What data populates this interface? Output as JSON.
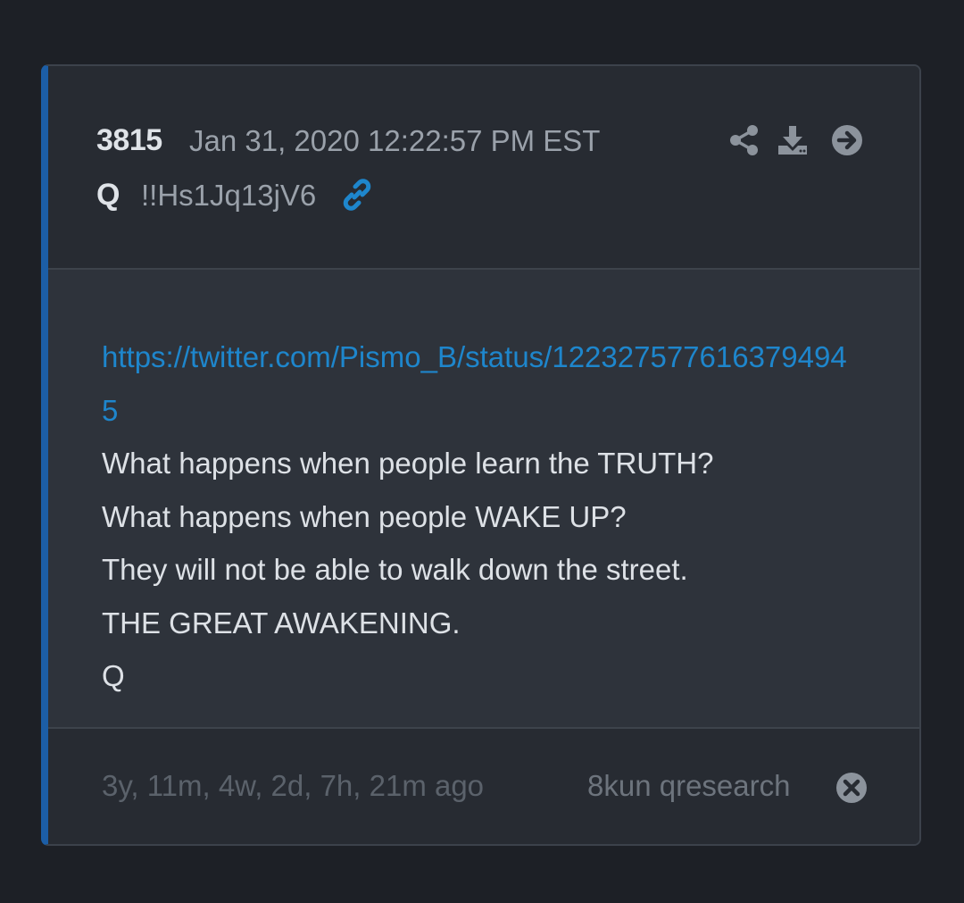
{
  "post": {
    "number": "3815",
    "date": "Jan 31, 2020 12:22:57 PM EST",
    "author": "Q",
    "tripcode": "!!Hs1Jq13jV6",
    "link": "https://twitter.com/Pismo_B/status/1223275776163794945",
    "lines": [
      "What happens when people learn the TRUTH?",
      "What happens when people WAKE UP?",
      "They will not be able to walk down the street.",
      "THE GREAT AWAKENING.",
      "Q"
    ],
    "time_ago": "3y, 11m, 4w, 2d, 7h, 21m ago",
    "source": "8kun qresearch"
  },
  "icons": {
    "share": "share-icon",
    "download": "download-icon",
    "next": "arrow-right-circle-icon",
    "permalink": "link-icon",
    "close": "close-circle-icon"
  },
  "colors": {
    "accent_bar": "#1c5ea6",
    "link": "#1e86cc",
    "background": "#1d2026",
    "card": "#272b32",
    "body": "#2e333b"
  }
}
